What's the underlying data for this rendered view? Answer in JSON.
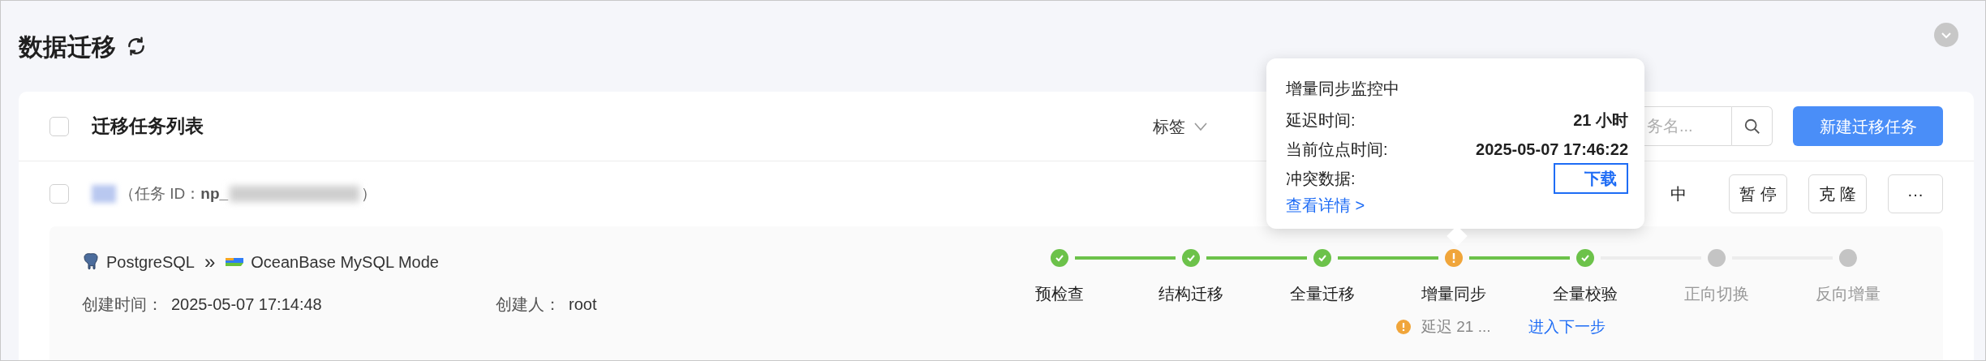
{
  "page": {
    "title": "数据迁移"
  },
  "list": {
    "title": "迁移任务列表",
    "checked": false,
    "tag_filter": "标签",
    "search": {
      "placeholder": "务名..."
    },
    "new_button": "新建迁移任务"
  },
  "task": {
    "checked": false,
    "id_prefix": "（任务 ID：",
    "id_visible": "np_",
    "id_suffix": "）",
    "status": "中",
    "actions": [
      "暂 停",
      "克 隆",
      "···"
    ],
    "source": "PostgreSQL",
    "separator": "»",
    "target": "OceanBase MySQL Mode",
    "created_label": "创建时间：",
    "created": "2025-05-07 17:14:48",
    "creator_label": "创建人：",
    "creator": "root",
    "steps": [
      {
        "kind": "done",
        "label": "预检查"
      },
      {
        "kind": "done",
        "label": "结构迁移"
      },
      {
        "kind": "done",
        "label": "全量迁移"
      },
      {
        "kind": "warning",
        "label": "增量同步"
      },
      {
        "kind": "done",
        "label": "全量校验"
      },
      {
        "kind": "pending",
        "label": "正向切换"
      },
      {
        "kind": "pending",
        "label": "反向增量"
      }
    ],
    "delay_note": "延迟 21 ...",
    "next_step": "进入下一步"
  },
  "tooltip": {
    "title": "增量同步监控中",
    "rows": [
      {
        "kind": "value",
        "label": "延迟时间:",
        "value": "21 小时"
      },
      {
        "kind": "value",
        "label": "当前位点时间:",
        "value": "2025-05-07 17:46:22"
      },
      {
        "kind": "link",
        "label": "冲突数据:",
        "value": "下载"
      }
    ],
    "details_link": "查看详情 >"
  }
}
